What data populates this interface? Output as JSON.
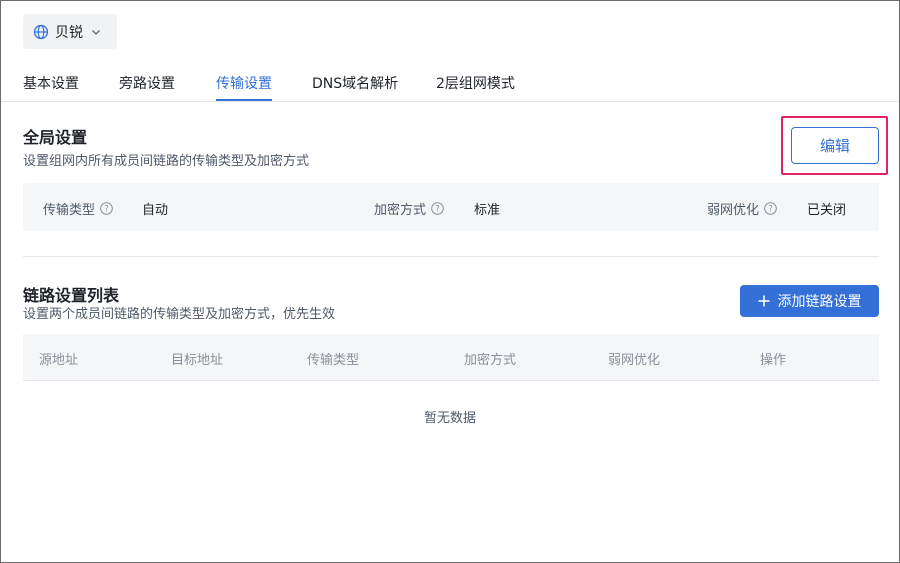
{
  "org_selector": {
    "label": "贝锐"
  },
  "tabs": [
    {
      "label": "基本设置"
    },
    {
      "label": "旁路设置"
    },
    {
      "label": "传输设置",
      "active": true
    },
    {
      "label": "DNS域名解析"
    },
    {
      "label": "2层组网模式"
    }
  ],
  "global": {
    "title": "全局设置",
    "description": "设置组网内所有成员间链路的传输类型及加密方式",
    "edit_label": "编辑",
    "fields": [
      {
        "label": "传输类型",
        "value": "自动"
      },
      {
        "label": "加密方式",
        "value": "标准"
      },
      {
        "label": "弱网优化",
        "value": "已关闭"
      }
    ]
  },
  "link_list": {
    "title": "链路设置列表",
    "description": "设置两个成员间链路的传输类型及加密方式，优先生效",
    "add_label": "添加链路设置",
    "columns": [
      "源地址",
      "目标地址",
      "传输类型",
      "加密方式",
      "弱网优化",
      "操作"
    ],
    "empty_text": "暂无数据"
  },
  "colors": {
    "accent": "#3370d8",
    "highlight": "#e0245e"
  }
}
